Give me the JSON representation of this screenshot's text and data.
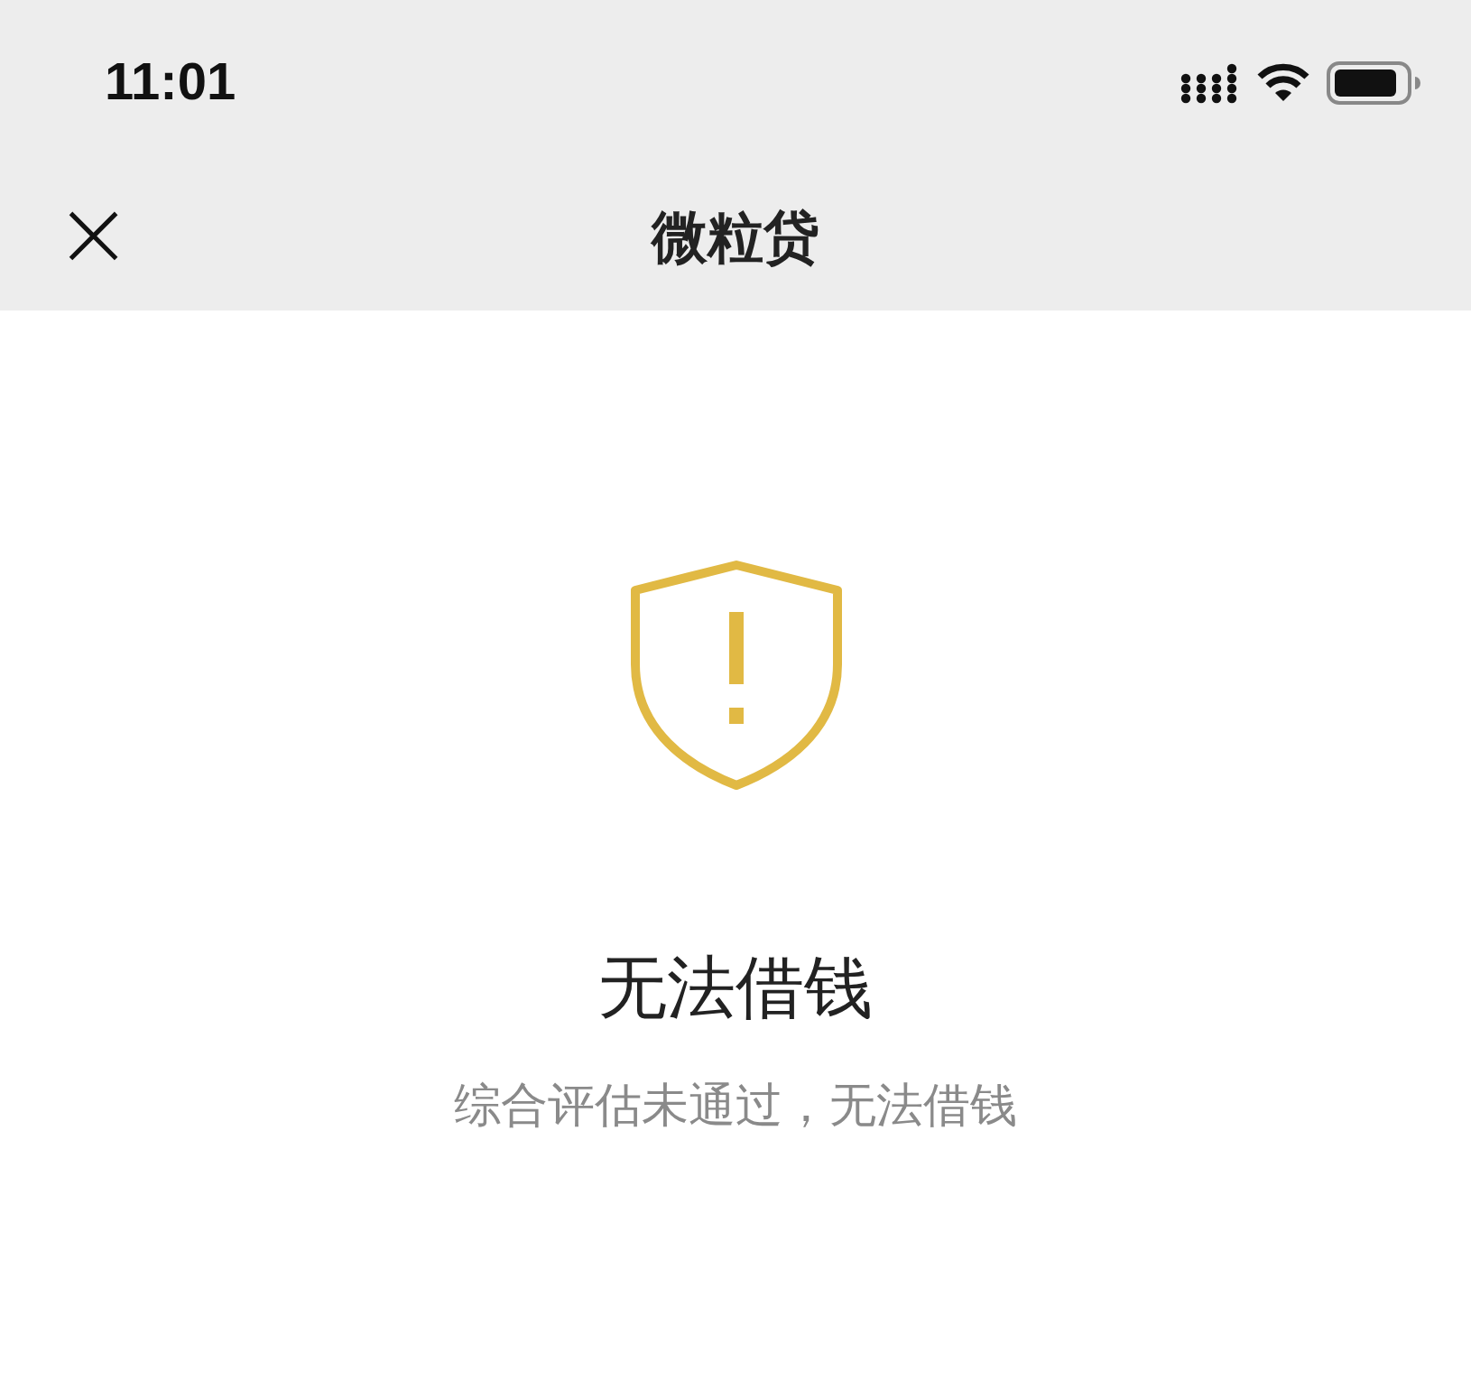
{
  "status_bar": {
    "time": "11:01"
  },
  "nav_bar": {
    "close": "×",
    "title": "微粒贷"
  },
  "result": {
    "title": "无法借钱",
    "message": "综合评估未通过，无法借钱"
  }
}
